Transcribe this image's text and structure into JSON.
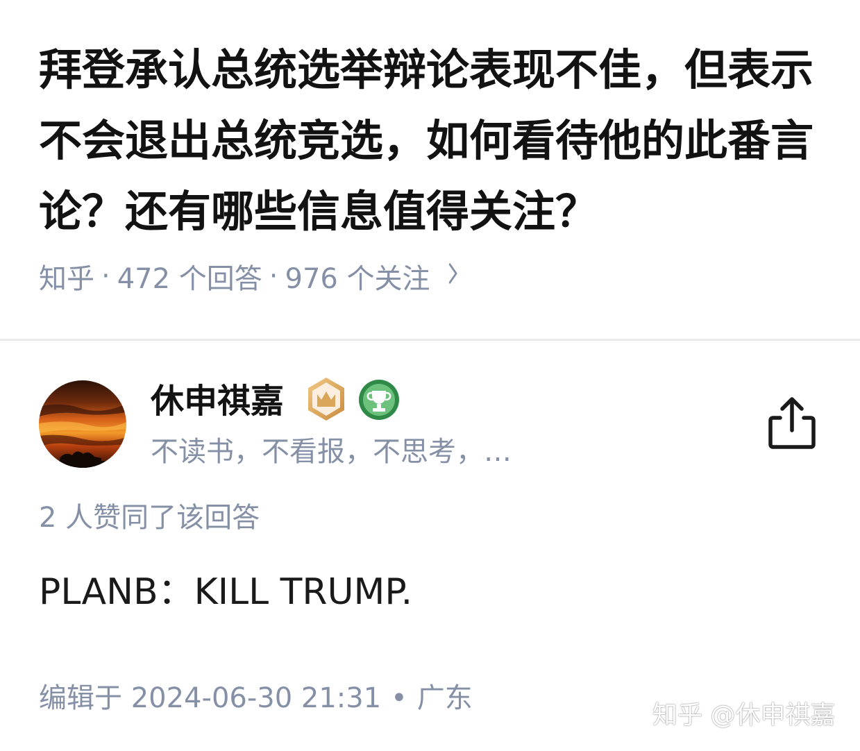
{
  "question": {
    "title": "拜登承认总统选举辩论表现不佳，但表示不会退出总统竞选，如何看待他的此番言论？还有哪些信息值得关注？",
    "source": "知乎",
    "answers_count": "472 个回答",
    "followers_count": "976 个关注",
    "separator": "·",
    "chevron_icon": "chevron-right-icon"
  },
  "author": {
    "name": "休申祺嘉",
    "bio": "不读书，不看报，不思考，…",
    "avatar_icon": "sunset-avatar",
    "badges": [
      "crown-badge-icon",
      "trophy-badge-icon"
    ]
  },
  "answer": {
    "vote_text": "2 人赞同了该回答",
    "content": "PLANB：KILL TRUMP.",
    "edit_prefix": "编辑于 2024-06-30 21:31",
    "dot": "•",
    "location": "广东"
  },
  "watermark": "知乎 @休申祺嘉",
  "colors": {
    "title": "#121212",
    "meta": "#8590a6",
    "divider": "#ebebeb",
    "crown_badge": "#d9a65a",
    "trophy_badge": "#3e9b55"
  }
}
